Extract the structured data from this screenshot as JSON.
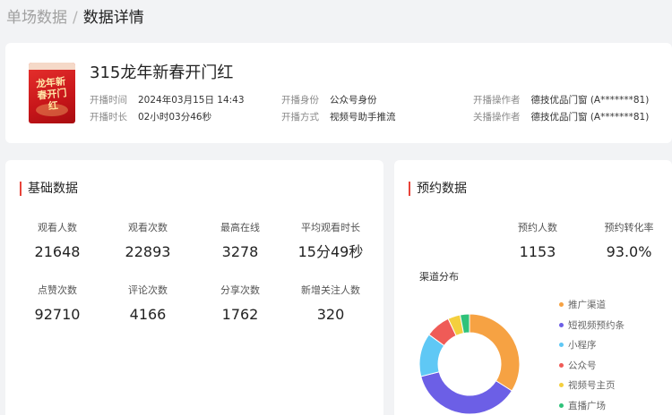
{
  "breadcrumb": {
    "parent": "单场数据",
    "separator": "/",
    "current": "数据详情"
  },
  "live": {
    "cover_text": "龙年新春开门红",
    "title": "315龙年新春开门红",
    "meta": [
      {
        "label": "开播时间",
        "value": "2024年03月15日 14:43"
      },
      {
        "label": "开播身份",
        "value": "公众号身份"
      },
      {
        "label": "开播操作者",
        "value": "德技优品门窗 (A*******81)"
      },
      {
        "label": "开播时长",
        "value": "02小时03分46秒"
      },
      {
        "label": "开播方式",
        "value": "视频号助手推流"
      },
      {
        "label": "关播操作者",
        "value": "德技优品门窗 (A*******81)"
      }
    ]
  },
  "basic": {
    "title": "基础数据",
    "stats": [
      {
        "label": "观看人数",
        "value": "21648"
      },
      {
        "label": "观看次数",
        "value": "22893"
      },
      {
        "label": "最高在线",
        "value": "3278"
      },
      {
        "label": "平均观看时长",
        "value": "15分49秒"
      },
      {
        "label": "点赞次数",
        "value": "92710"
      },
      {
        "label": "评论次数",
        "value": "4166"
      },
      {
        "label": "分享次数",
        "value": "1762"
      },
      {
        "label": "新增关注人数",
        "value": "320"
      }
    ]
  },
  "reservation": {
    "title": "预约数据",
    "stats": [
      {
        "label": "预约人数",
        "value": "1153"
      },
      {
        "label": "预约转化率",
        "value": "93.0%"
      }
    ],
    "channel_title": "渠道分布",
    "channels": [
      {
        "name": "推广渠道",
        "color": "#f6a243",
        "share": 0.34
      },
      {
        "name": "短视频预约条",
        "color": "#6c5fe6",
        "share": 0.37
      },
      {
        "name": "小程序",
        "color": "#5fc8f5",
        "share": 0.14
      },
      {
        "name": "公众号",
        "color": "#ef5b57",
        "share": 0.08
      },
      {
        "name": "视频号主页",
        "color": "#f4cf3e",
        "share": 0.04
      },
      {
        "name": "直播广场",
        "color": "#2fc27a",
        "share": 0.03
      }
    ]
  }
}
